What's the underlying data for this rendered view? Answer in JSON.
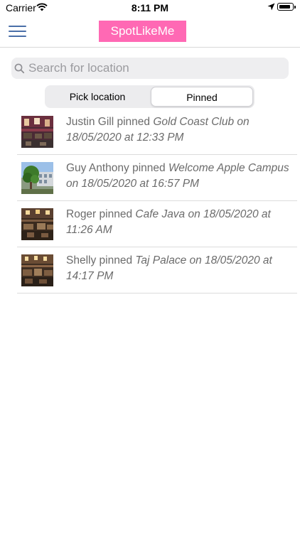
{
  "status_bar": {
    "carrier": "Carrier",
    "time": "8:11 PM"
  },
  "nav": {
    "title": "SpotLikeMe",
    "title_bg": "#ff69b4"
  },
  "search": {
    "placeholder": "Search for location",
    "value": ""
  },
  "segments": [
    {
      "label": "Pick location",
      "selected": false
    },
    {
      "label": "Pinned",
      "selected": true
    }
  ],
  "pins": [
    {
      "user": "Justin Gill",
      "verb": " pinned ",
      "detail": "Gold Coast Club on 18/05/2020 at 12:33 PM",
      "thumbnail_icon": "restaurant-photo"
    },
    {
      "user": "Guy Anthony",
      "verb": " pinned ",
      "detail": "Welcome Apple Campus on 18/05/2020 at 16:57 PM",
      "thumbnail_icon": "campus-photo"
    },
    {
      "user": "Roger",
      "verb": " pinned ",
      "detail": "Cafe Java on 18/05/2020 at 11:26 AM",
      "thumbnail_icon": "cafe-photo"
    },
    {
      "user": "Shelly",
      "verb": " pinned ",
      "detail": "Taj Palace on 18/05/2020 at 14:17 PM",
      "thumbnail_icon": "restaurant-photo"
    }
  ],
  "colors": {
    "menu_icon": "#4a6fa8",
    "pin_text": "#6b6b6b"
  }
}
